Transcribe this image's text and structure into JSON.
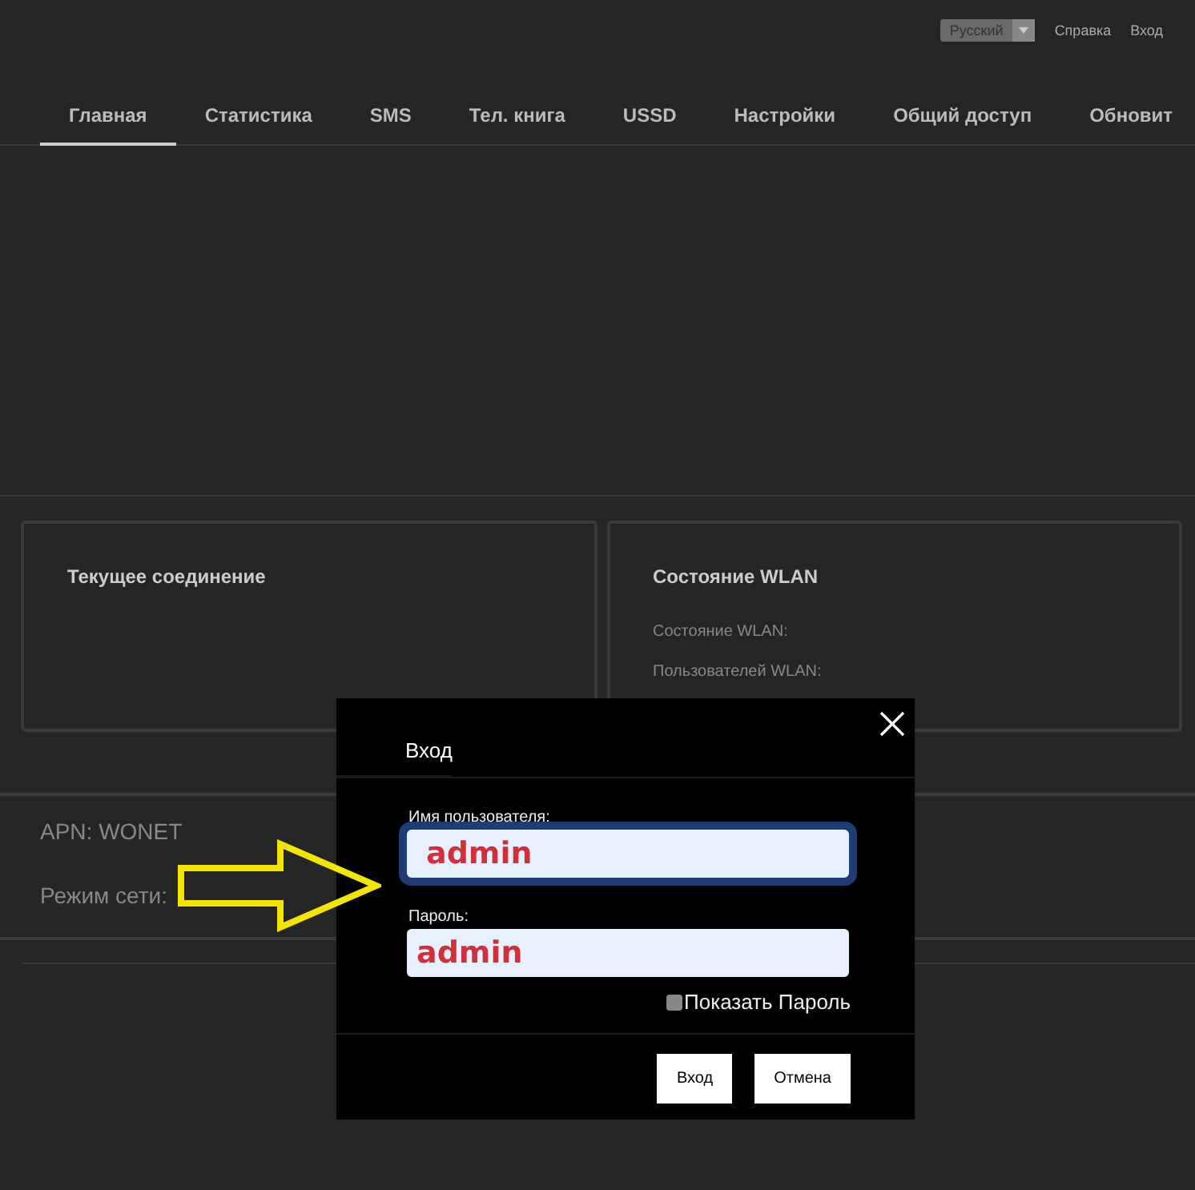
{
  "header": {
    "language": "Русский",
    "links": [
      "Справка",
      "Вход"
    ]
  },
  "tabs": [
    {
      "label": "Главная",
      "selected": true
    },
    {
      "label": "Статистика",
      "selected": false
    },
    {
      "label": "SMS",
      "selected": false
    },
    {
      "label": "Тел. книга",
      "selected": false
    },
    {
      "label": "USSD",
      "selected": false
    },
    {
      "label": "Настройки",
      "selected": false
    },
    {
      "label": "Общий доступ",
      "selected": false
    },
    {
      "label": "Обновит",
      "selected": false
    }
  ],
  "cards": [
    {
      "title": "Текущее соединение"
    },
    {
      "title": "Состояние WLAN",
      "rows": [
        "Состояние WLAN:",
        "Пользователей WLAN:"
      ]
    }
  ],
  "info": [
    "APN: WONET",
    "Режим сети:"
  ],
  "dialog": {
    "title": "Вход",
    "fields": [
      {
        "label": "Имя пользователя:",
        "value": "admin",
        "focused": true
      },
      {
        "label": "Пароль:",
        "value": "admin",
        "focused": false
      }
    ],
    "show_password": {
      "label": "Показать Пароль",
      "checked": false
    },
    "buttons": [
      "Вход",
      "Отмена"
    ]
  }
}
